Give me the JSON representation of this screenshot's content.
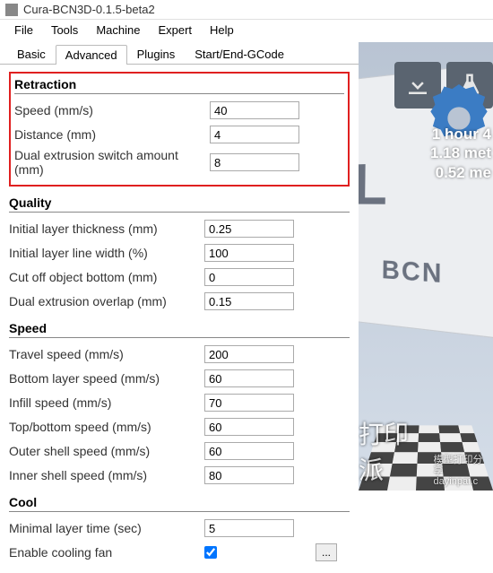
{
  "window": {
    "title": "Cura-BCN3D-0.1.5-beta2"
  },
  "menu": {
    "file": "File",
    "tools": "Tools",
    "machine": "Machine",
    "expert": "Expert",
    "help": "Help"
  },
  "tabs": {
    "basic": "Basic",
    "advanced": "Advanced",
    "plugins": "Plugins",
    "startend": "Start/End-GCode"
  },
  "sections": {
    "retraction": {
      "title": "Retraction",
      "speed": {
        "label": "Speed (mm/s)",
        "value": "40"
      },
      "distance": {
        "label": "Distance (mm)",
        "value": "4"
      },
      "dual_switch": {
        "label": "Dual extrusion switch amount (mm)",
        "value": "8"
      }
    },
    "quality": {
      "title": "Quality",
      "ilt": {
        "label": "Initial layer thickness (mm)",
        "value": "0.25"
      },
      "illw": {
        "label": "Initial layer line width (%)",
        "value": "100"
      },
      "cutoff": {
        "label": "Cut off object bottom (mm)",
        "value": "0"
      },
      "dual_overlap": {
        "label": "Dual extrusion overlap (mm)",
        "value": "0.15"
      }
    },
    "speed": {
      "title": "Speed",
      "travel": {
        "label": "Travel speed (mm/s)",
        "value": "200"
      },
      "bottom": {
        "label": "Bottom layer speed (mm/s)",
        "value": "60"
      },
      "infill": {
        "label": "Infill speed (mm/s)",
        "value": "70"
      },
      "topbottom": {
        "label": "Top/bottom speed (mm/s)",
        "value": "60"
      },
      "outer": {
        "label": "Outer shell speed (mm/s)",
        "value": "60"
      },
      "inner": {
        "label": "Inner shell speed (mm/s)",
        "value": "80"
      }
    },
    "cool": {
      "title": "Cool",
      "minlayer": {
        "label": "Minimal layer time (sec)",
        "value": "5"
      },
      "enablefan": {
        "label": "Enable cooling fan"
      },
      "more": "..."
    }
  },
  "viewport": {
    "card": {
      "letter": "L",
      "brand": "BCN"
    },
    "stats": {
      "l1": "1 hour 4",
      "l2": "1.18 met",
      "l3": "0.52 me"
    }
  },
  "watermark": {
    "logo": "打印派",
    "sub1": "模型打印分享",
    "sub2": "dayinpai.c"
  }
}
